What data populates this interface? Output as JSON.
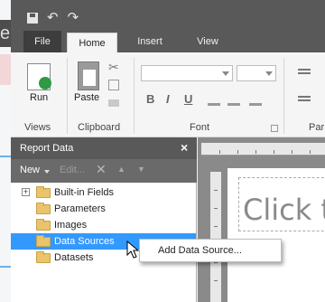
{
  "background": {
    "partial_title_text": "e",
    "accent_color": "#6fb0e8"
  },
  "titlebar": {
    "save_icon": "save-icon",
    "undo_icon": "undo-icon",
    "redo_icon": "redo-icon"
  },
  "tabs": {
    "file": "File",
    "home": "Home",
    "insert": "Insert",
    "view": "View"
  },
  "ribbon": {
    "run_label": "Run",
    "views_group": "Views",
    "paste_label": "Paste",
    "clipboard_group": "Clipboard",
    "font_group": "Font",
    "paragraph_group": "Par",
    "bold": "B",
    "italic": "I",
    "underline": "U"
  },
  "report_data": {
    "title": "Report Data",
    "close": "×",
    "toolbar": {
      "new_label": "New",
      "edit_label": "Edit...",
      "delete_icon": "✕",
      "up_icon": "▲",
      "down_icon": "▼"
    },
    "items": [
      {
        "label": "Built-in Fields",
        "expandable": true,
        "expander": "+",
        "selected": false
      },
      {
        "label": "Parameters",
        "expandable": false,
        "selected": false
      },
      {
        "label": "Images",
        "expandable": false,
        "selected": false
      },
      {
        "label": "Data Sources",
        "expandable": false,
        "selected": true
      },
      {
        "label": "Datasets",
        "expandable": false,
        "selected": false
      }
    ],
    "selected_color": "#3399ff"
  },
  "design": {
    "title_placeholder": "Click t"
  },
  "context_menu": {
    "items": [
      {
        "label": "Add Data Source..."
      }
    ]
  }
}
